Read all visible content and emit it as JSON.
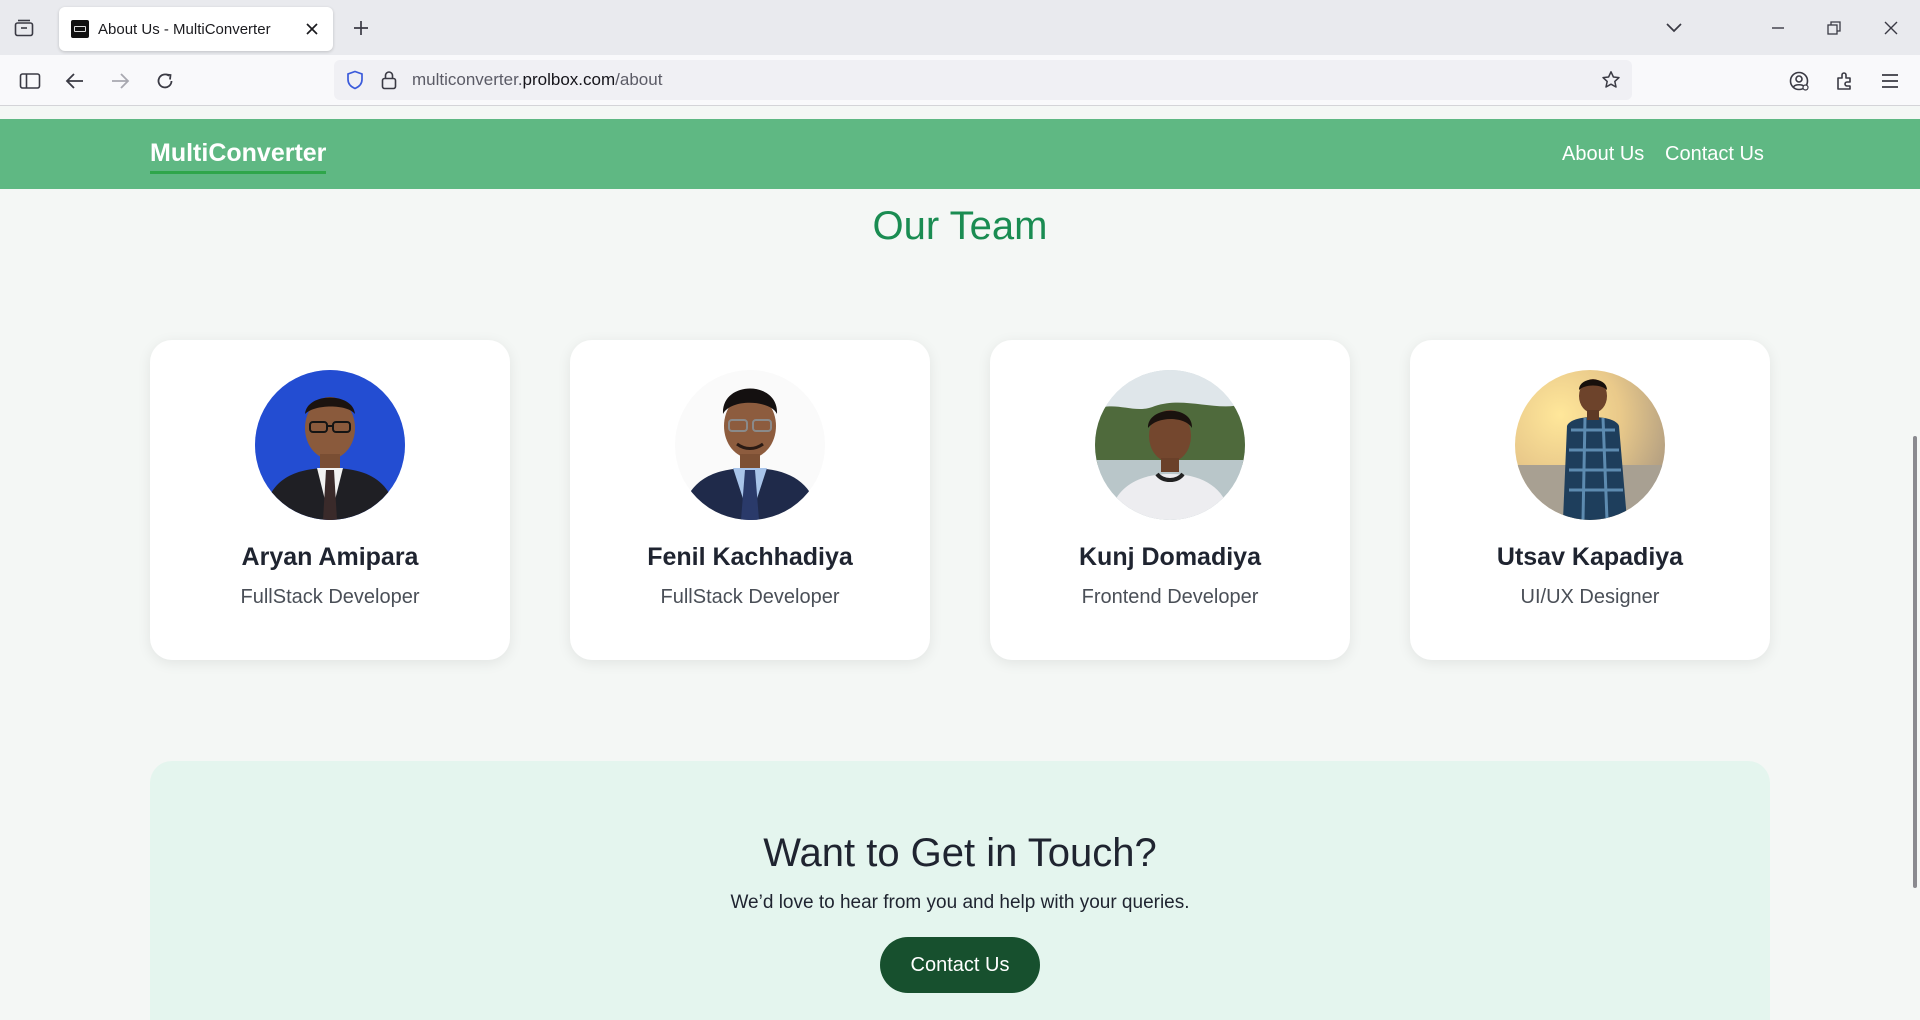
{
  "browser": {
    "tab": {
      "title": "About Us - MultiConverter"
    },
    "url": {
      "host_prefix": "multiconverter.",
      "host": "prolbox.com",
      "path": "/about"
    }
  },
  "site": {
    "brand": "MultiConverter",
    "nav": [
      {
        "label": "About Us"
      },
      {
        "label": "Contact Us"
      }
    ]
  },
  "team": {
    "title": "Our Team",
    "members": [
      {
        "name": "Aryan Amipara",
        "role": "FullStack Developer"
      },
      {
        "name": "Fenil Kachhadiya",
        "role": "FullStack Developer"
      },
      {
        "name": "Kunj Domadiya",
        "role": "Frontend Developer"
      },
      {
        "name": "Utsav Kapadiya",
        "role": "UI/UX Designer"
      }
    ]
  },
  "contact": {
    "title": "Want to Get in Touch?",
    "subtitle": "We’d love to hear from you and help with your queries.",
    "button": "Contact Us"
  },
  "colors": {
    "header": "#5fb883",
    "brand_underline": "#2ea64a",
    "team_title": "#1a8c52",
    "contact_band": "#e4f5ee",
    "contact_button": "#17502e"
  }
}
